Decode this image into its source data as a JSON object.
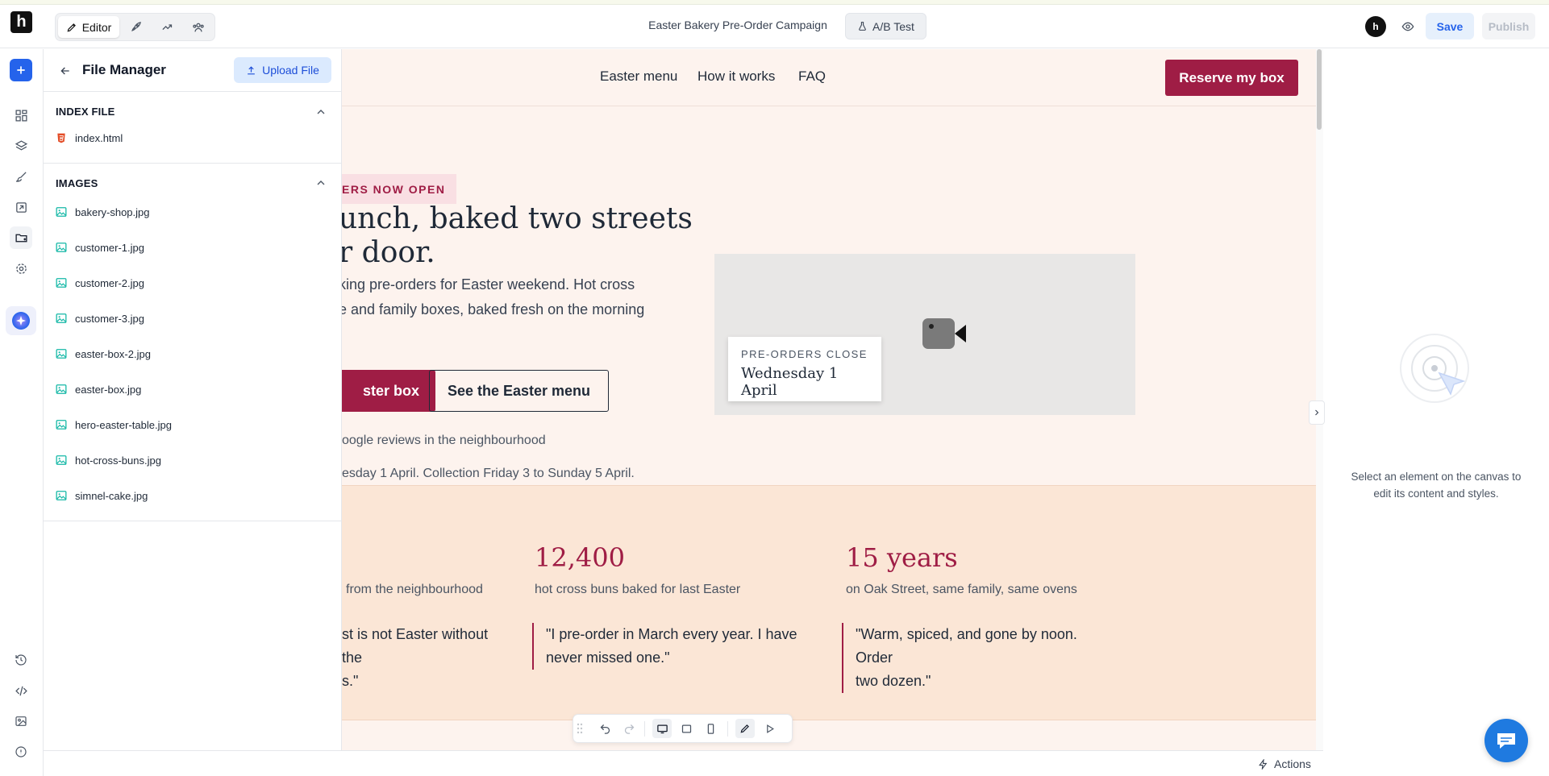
{
  "app": {
    "logo_letter": "h",
    "brand_color": "#111111",
    "accent": "#2563eb"
  },
  "topbar": {
    "modes": [
      {
        "label": "Editor",
        "icon": "pen-icon"
      },
      {
        "label": "",
        "icon": "rocket-icon"
      },
      {
        "label": "",
        "icon": "chart-icon"
      },
      {
        "label": "",
        "icon": "users-icon"
      }
    ],
    "campaign_title": "Easter Bakery Pre-Order Campaign",
    "ab_test_label": "A/B Test",
    "avatar_letter": "h",
    "save_label": "Save",
    "publish_label": "Publish"
  },
  "rail": {
    "items": [
      "add-icon",
      "pages-icon",
      "layers-icon",
      "brush-icon",
      "export-icon",
      "files-icon",
      "settings-icon",
      "ai-icon"
    ],
    "bottom_items": [
      "history-icon",
      "code-icon",
      "image-icon",
      "info-icon"
    ]
  },
  "file_manager": {
    "title": "File Manager",
    "upload_label": "Upload File",
    "index_section": "INDEX FILE",
    "index_files": [
      "index.html"
    ],
    "images_section": "IMAGES",
    "images": [
      "bakery-shop.jpg",
      "customer-1.jpg",
      "customer-2.jpg",
      "customer-3.jpg",
      "easter-box-2.jpg",
      "easter-box.jpg",
      "hero-easter-table.jpg",
      "hot-cross-buns.jpg",
      "simnel-cake.jpg"
    ]
  },
  "site": {
    "nav": [
      "Easter menu",
      "How it works",
      "FAQ"
    ],
    "reserve_cta": "Reserve my box",
    "eyebrow": "ERS NOW OPEN",
    "hero_title": "unch, baked two streets\nr door.",
    "hero_body": "king pre-orders for Easter weekend. Hot cross\ne and family boxes, baked fresh on the morning",
    "primary_cta": "ster box",
    "secondary_cta": "See the Easter menu",
    "reviews": "oogle reviews in the neighbourhood",
    "dates": "esday 1 April. Collection Friday 3 to Sunday 5 April.",
    "close_eyebrow": "PRE-ORDERS CLOSE",
    "close_date": "Wednesday 1 April",
    "stats": [
      {
        "num": "",
        "caption": "from the neighbourhood"
      },
      {
        "num": "12,400",
        "caption": "hot cross buns baked for last Easter"
      },
      {
        "num": "15 years",
        "caption": "on Oak Street, same family, same ovens"
      }
    ],
    "quotes": [
      "st is not Easter without the\ns.\"",
      "\"I pre-order in March every year. I have\nnever missed one.\"",
      "\"Warm, spiced, and gone by noon. Order\ntwo dozen.\""
    ],
    "brand_red": "#9f1d45"
  },
  "right_panel": {
    "hint": "Select an element on the canvas to edit its content and styles."
  },
  "statusbar": {
    "actions_label": "Actions"
  }
}
